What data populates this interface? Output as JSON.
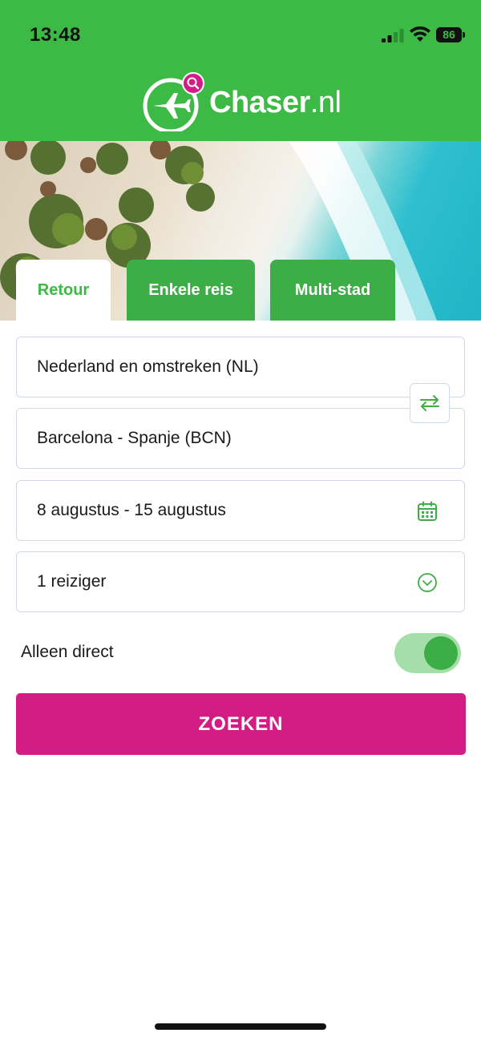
{
  "status_bar": {
    "time": "13:48",
    "battery": "86"
  },
  "brand": {
    "name": "Chaser",
    "tld": ".nl"
  },
  "tabs": [
    {
      "label": "Retour",
      "active": true
    },
    {
      "label": "Enkele reis",
      "active": false
    },
    {
      "label": "Multi-stad",
      "active": false
    }
  ],
  "form": {
    "origin": "Nederland en omstreken (NL)",
    "destination": "Barcelona - Spanje (BCN)",
    "dates": "8 augustus - 15 augustus",
    "travelers": "1 reiziger",
    "direct_label": "Alleen direct",
    "direct_only": true,
    "search_label": "ZOEKEN"
  },
  "colors": {
    "brand_green": "#3dba45",
    "accent_pink": "#d41d84",
    "border": "#cfd9e8"
  },
  "icons": [
    "airplane-logo-icon",
    "search-icon",
    "swap-icon",
    "calendar-icon",
    "chevron-down-icon",
    "signal-icon",
    "wifi-icon",
    "battery-icon"
  ]
}
